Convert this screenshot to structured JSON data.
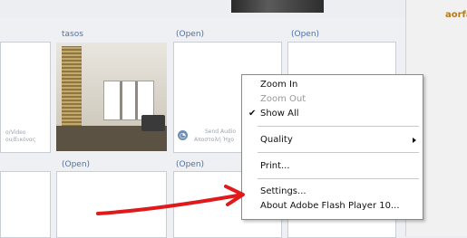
{
  "window": {
    "right_user_label": "aorfa"
  },
  "grid": {
    "top_labels": [
      "tasos",
      "(Open)",
      "(Open)"
    ],
    "bottom_labels": [
      "(Open)",
      "(Open)"
    ],
    "left_slot_text": [
      "o/Video",
      "ou/Εικόνας"
    ],
    "send_audio_text": [
      "Send Audio",
      "Αποστολή Ήχο"
    ]
  },
  "context_menu": {
    "items": [
      {
        "label": "Zoom In",
        "enabled": true,
        "checked": false,
        "submenu": false
      },
      {
        "label": "Zoom Out",
        "enabled": false,
        "checked": false,
        "submenu": false
      },
      {
        "label": "Show All",
        "enabled": true,
        "checked": true,
        "submenu": false
      },
      {
        "label": "Quality",
        "enabled": true,
        "checked": false,
        "submenu": true
      },
      {
        "label": "Print...",
        "enabled": true,
        "checked": false,
        "submenu": false
      },
      {
        "label": "Settings...",
        "enabled": true,
        "checked": false,
        "submenu": false
      },
      {
        "label": "About Adobe Flash Player 10...",
        "enabled": true,
        "checked": false,
        "submenu": false
      }
    ],
    "check_glyph": "✔"
  },
  "colors": {
    "slot_label": "#4a72b0",
    "annotation_arrow": "#e0191b",
    "user_label": "#b77a1e"
  },
  "icons": {
    "flash_icon": "flash-camera-icon",
    "check_icon": "check-icon",
    "submenu_icon": "chevron-right-icon"
  }
}
